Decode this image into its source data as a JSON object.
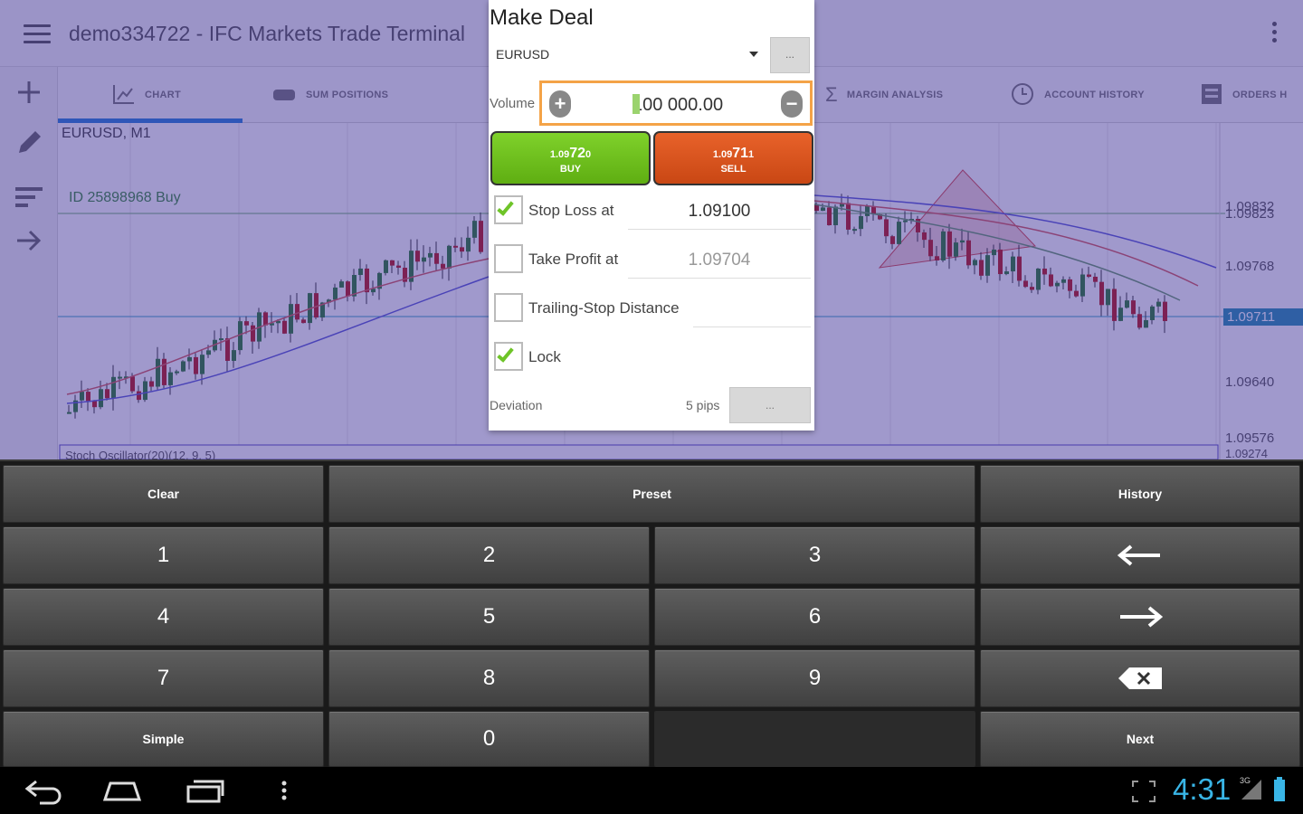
{
  "app": {
    "title": "demo334722 - IFC Markets Trade Terminal"
  },
  "tabs": [
    {
      "label": "CHART",
      "icon": "chart-icon",
      "active": true
    },
    {
      "label": "SUM POSITIONS",
      "icon": "positions-icon"
    },
    {
      "label": "MARGIN ANALYSIS",
      "icon": "sigma-icon"
    },
    {
      "label": "ACCOUNT HISTORY",
      "icon": "clock-icon"
    },
    {
      "label": "ORDERS H",
      "icon": "orders-icon"
    }
  ],
  "left_tools": [
    "add-icon",
    "pencil-icon",
    "list-icon",
    "arrow-right-icon"
  ],
  "chart": {
    "symbol": "EURUSD, M1",
    "order_line_label": "ID 25898968 Buy",
    "price_axis": [
      "1.09832",
      "1.09823",
      "1.09768",
      "1.09711",
      "1.09640",
      "1.09576",
      "1.09274"
    ],
    "current_price": "1.09711",
    "indicator_label": "Stoch Oscillator(20)(12, 9, 5)"
  },
  "deal": {
    "title": "Make Deal",
    "symbol": "EURUSD",
    "symbol_button": "...",
    "volume_label": "Volume",
    "volume_cursor_char": "1",
    "volume_rest": "00 000.00",
    "buy": {
      "price_main": "1.09",
      "price_big": "72",
      "price_small": "0",
      "label": "BUY"
    },
    "sell": {
      "price_main": "1.09",
      "price_big": "71",
      "price_small": "1",
      "label": "SELL"
    },
    "stop_loss": {
      "label": "Stop Loss at",
      "value": "1.09100",
      "checked": true
    },
    "take_profit": {
      "label": "Take Profit at",
      "value": "1.09704",
      "checked": false
    },
    "trailing_stop": {
      "label": "Trailing-Stop Distance",
      "value": "",
      "checked": false
    },
    "lock": {
      "label": "Lock",
      "checked": true
    },
    "deviation": {
      "label": "Deviation",
      "value": "5 pips",
      "button": "..."
    }
  },
  "keyboard": {
    "clear": "Clear",
    "preset": "Preset",
    "history": "History",
    "digits": [
      "1",
      "2",
      "3",
      "4",
      "5",
      "6",
      "7",
      "8",
      "9",
      "0"
    ],
    "simple": "Simple",
    "next": "Next",
    "left_arrow": "left-arrow-icon",
    "right_arrow": "right-arrow-icon",
    "backspace": "backspace-icon"
  },
  "status": {
    "clock": "4:31",
    "signal": "3G"
  },
  "colors": {
    "buy": "#6cc11f",
    "sell": "#d9541d",
    "volume_border": "#f4a347",
    "checkbox_tick": "#6ec428",
    "clock": "#39b5e6",
    "overlay": "#372896"
  }
}
